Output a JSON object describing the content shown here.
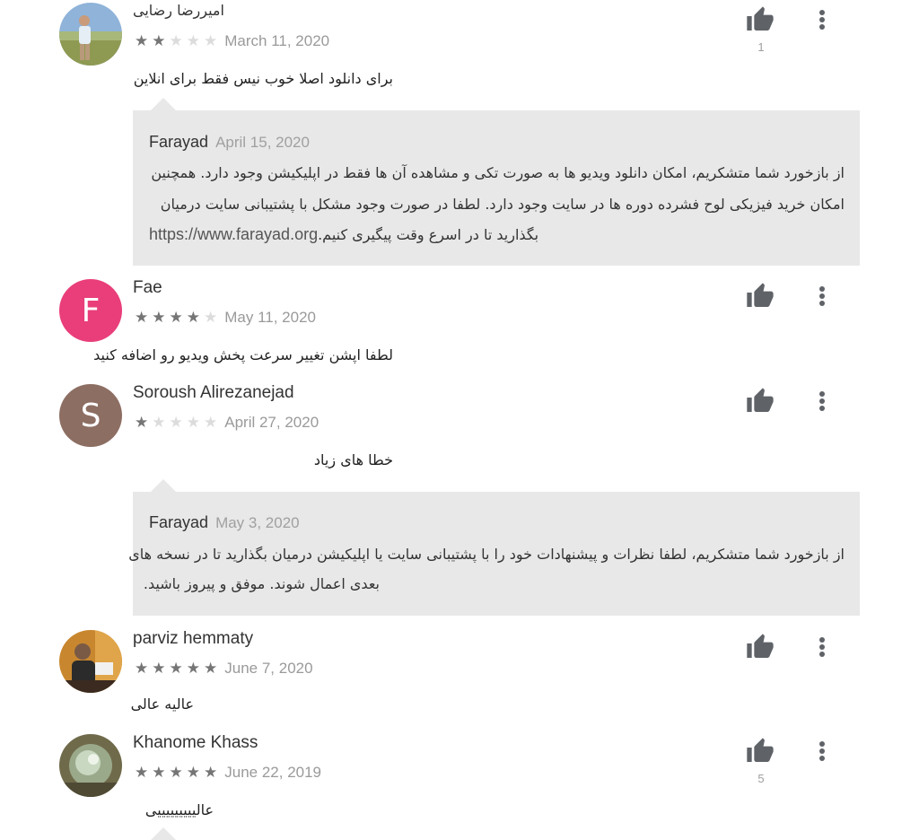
{
  "colors": {
    "accent_fae": "#e93e7a",
    "accent_soroush": "#8d6e63",
    "reply_bg": "#e8e8e8",
    "star_on": "#757575",
    "star_off": "#dcdcdc"
  },
  "reviews": [
    {
      "name": "امیررضا رضایی",
      "rating": 2,
      "date": "March 11, 2020",
      "text": "برای دانلود اصلا خوب نیس فقط برای انلاین",
      "helpful_count": "1",
      "avatar": "photo-person-outdoors",
      "reply": {
        "developer": "Farayad",
        "date": "April 15, 2020",
        "lines": [
          "از بازخورد شما متشکریم، امکان دانلود ویدیو ها به صورت تکی و مشاهده آن ها فقط در اپلیکیشن وجود دارد. همچنین",
          "امکان خرید فیزیکی لوح فشرده دوره ها در سایت وجود دارد. لطفا در صورت وجود مشکل با پشتیبانی سایت درمیان",
          "بگذارید تا در اسرع وقت پیگیری کنیم."
        ],
        "url": "https://www.farayad.org"
      }
    },
    {
      "name": "Fae",
      "initial": "F",
      "rating": 4,
      "date": "May 11, 2020",
      "text": "لطفا اپشن تغییر سرعت پخش ویدیو رو اضافه کنید",
      "helpful_count": ""
    },
    {
      "name": "Soroush Alirezanejad",
      "initial": "S",
      "rating": 1,
      "date": "April 27, 2020",
      "text": "خطا های زیاد",
      "helpful_count": "",
      "reply": {
        "developer": "Farayad",
        "date": "May 3, 2020",
        "lines": [
          "از بازخورد شما متشکریم، لطفا نظرات و پیشنهادات خود را با پشتیبانی سایت یا اپلیکیشن درمیان بگذارید تا در نسخه های",
          "بعدی اعمال شوند. موفق و پیروز باشید."
        ]
      }
    },
    {
      "name": "parviz hemmaty",
      "rating": 5,
      "date": "June 7, 2020",
      "text": "عالیه عالی",
      "helpful_count": "",
      "avatar": "photo-person-sitting"
    },
    {
      "name": "Khanome Khass",
      "rating": 5,
      "date": "June 22, 2019",
      "text": "عالیییییییییی",
      "helpful_count": "5",
      "avatar": "photo-crystal"
    }
  ]
}
